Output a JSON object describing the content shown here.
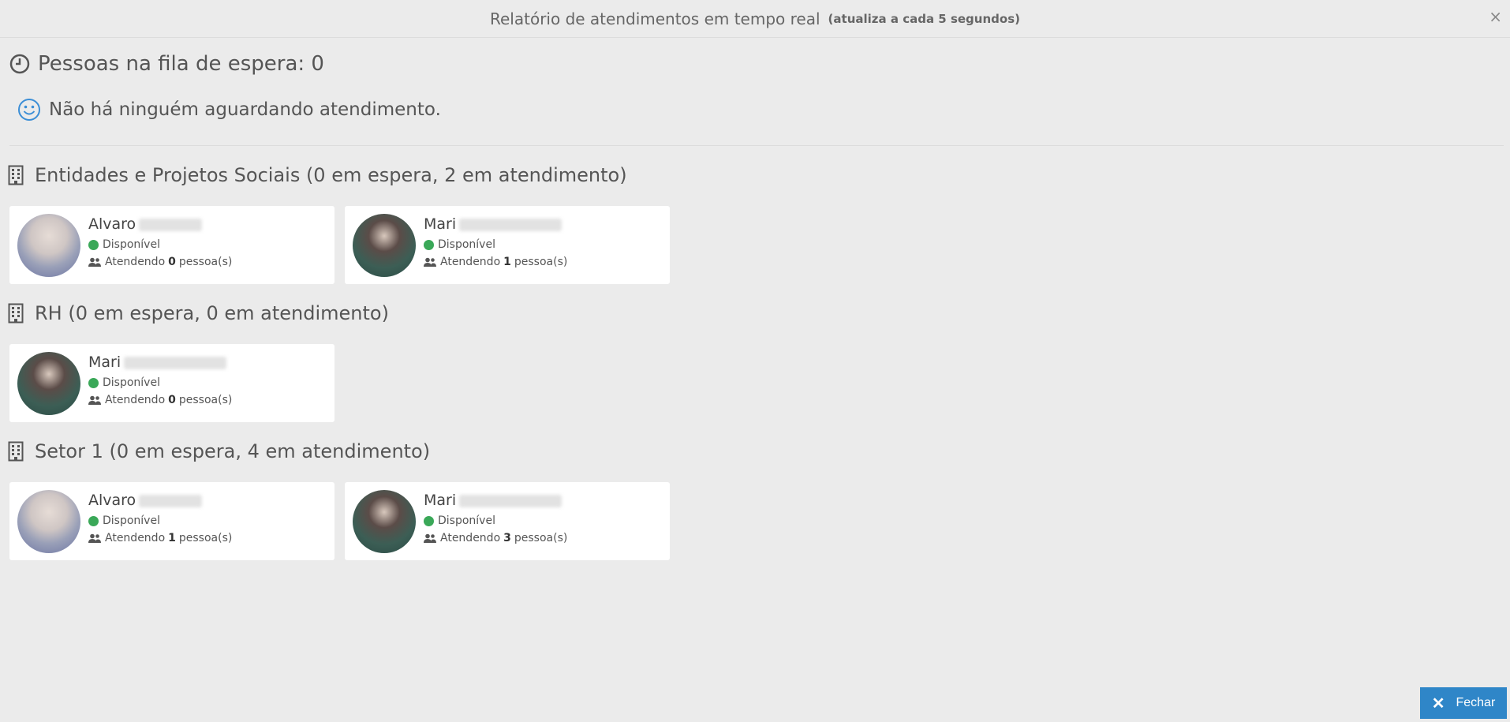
{
  "header": {
    "title": "Relatório de atendimentos em tempo real",
    "subtitle": "(atualiza a cada 5 segundos)",
    "close_glyph": "×"
  },
  "queue": {
    "title": "Pessoas na fila de espera: 0",
    "empty_message": "Não há ninguém aguardando atendimento.",
    "icons": {
      "clock": "clock-icon",
      "smile": "smile-icon"
    }
  },
  "sections": [
    {
      "title": "Entidades e Projetos Sociais (0 em espera, 2 em atendimento)",
      "cards": [
        {
          "first_name": "Alvaro",
          "status": "Disponível",
          "serving_prefix": "Atendendo",
          "serving_count": "0",
          "serving_suffix": "pessoa(s)"
        },
        {
          "first_name": "Mari",
          "status": "Disponível",
          "serving_prefix": "Atendendo",
          "serving_count": "1",
          "serving_suffix": "pessoa(s)"
        }
      ]
    },
    {
      "title": "RH (0 em espera, 0 em atendimento)",
      "cards": [
        {
          "first_name": "Mari",
          "status": "Disponível",
          "serving_prefix": "Atendendo",
          "serving_count": "0",
          "serving_suffix": "pessoa(s)"
        }
      ]
    },
    {
      "title": "Setor 1 (0 em espera, 4 em atendimento)",
      "cards": [
        {
          "first_name": "Alvaro",
          "status": "Disponível",
          "serving_prefix": "Atendendo",
          "serving_count": "1",
          "serving_suffix": "pessoa(s)"
        },
        {
          "first_name": "Mari",
          "status": "Disponível",
          "serving_prefix": "Atendendo",
          "serving_count": "3",
          "serving_suffix": "pessoa(s)"
        }
      ]
    }
  ],
  "footer": {
    "close_label": "Fechar",
    "close_glyph": "✕"
  },
  "colors": {
    "status_available": "#3aa858",
    "accent": "#2f86c8",
    "smile_icon": "#3b8ed6"
  }
}
